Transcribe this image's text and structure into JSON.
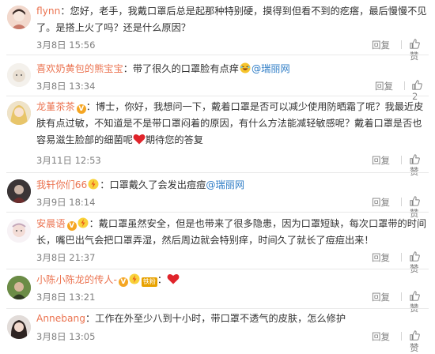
{
  "comments": [
    {
      "username": "flynn",
      "text": "您好，老手，我戴口罩后总是起那种特别硬，摸得到但看不到的疙瘩，最后慢慢不见了。是搭上火了吗？还是什么原因？",
      "time": "3月8日 15:56",
      "reply_label": "回复",
      "like_label": "赞",
      "like_count": ""
    },
    {
      "username": "喜欢奶黄包的熊宝宝",
      "text_before": "带了很久的口罩脸有点痒",
      "mention": "@瑞丽网",
      "time": "3月8日 13:34",
      "reply_label": "回复",
      "like_count": "2"
    },
    {
      "username": "龙堇茶茶",
      "text_before": "博士，你好，我想问一下，戴着口罩是否可以减少使用防晒霜了呢？我最近皮肤有点过敏，不知道是不是带口罩闷着的原因，有什么方法能减轻敏感呢？戴着口罩是否也容易滋生脸部的细菌呢",
      "text_after": "期待您的答复",
      "time": "3月11日 12:53",
      "reply_label": "回复",
      "like_label": "赞"
    },
    {
      "username": "我轩你们66",
      "text_before": "口罩戴久了会发出痘痘",
      "mention": "@瑞丽网",
      "time": "3月9日 18:14",
      "reply_label": "回复",
      "like_label": "赞"
    },
    {
      "username": "安晨语",
      "text": "戴口罩虽然安全，但是也带来了很多隐患，因为口罩短缺，每次口罩带的时间长，嘴巴出气会把口罩弄湿，然后周边就会特别痒，时间久了就长了痘痘出来！",
      "time": "3月8日 21:37",
      "reply_label": "回复",
      "like_label": "赞"
    },
    {
      "username": "小陈小陈龙的传人-",
      "fan_badge": "铁粉",
      "time": "3月8日 13:21",
      "reply_label": "回复",
      "like_label": "赞"
    },
    {
      "username": "Annebang",
      "text": "工作在外至少八到十小时，带口罩不透气的皮肤，怎么修护",
      "time": "3月8日 13:05",
      "reply_label": "回复",
      "like_label": "赞"
    }
  ],
  "colors": {
    "username": "#eb7350",
    "mention": "#2f7dc6",
    "meta": "#808080",
    "heart": "#e0242b"
  },
  "icons": [
    "thumbs-up-icon",
    "heart-icon",
    "laughing-emoji-icon",
    "lightning-emoji-icon",
    "verified-v-icon",
    "level-badge-icon"
  ]
}
